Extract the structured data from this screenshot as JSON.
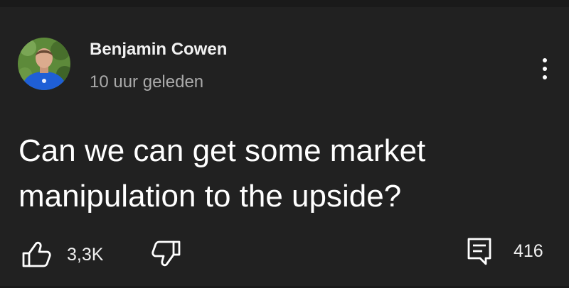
{
  "comment": {
    "author": "Benjamin Cowen",
    "timestamp": "10 uur geleden",
    "text": "Can we can get some market manipulation to the upside?"
  },
  "actions": {
    "likes": "3,3K",
    "replies": "416"
  },
  "icons": {
    "menu": "more-vert-icon",
    "like": "thumbs-up-icon",
    "dislike": "thumbs-down-icon",
    "reply": "comment-icon"
  },
  "colors": {
    "background": "#212121",
    "primary_text": "#ffffff",
    "secondary_text": "#aaaaaa"
  }
}
